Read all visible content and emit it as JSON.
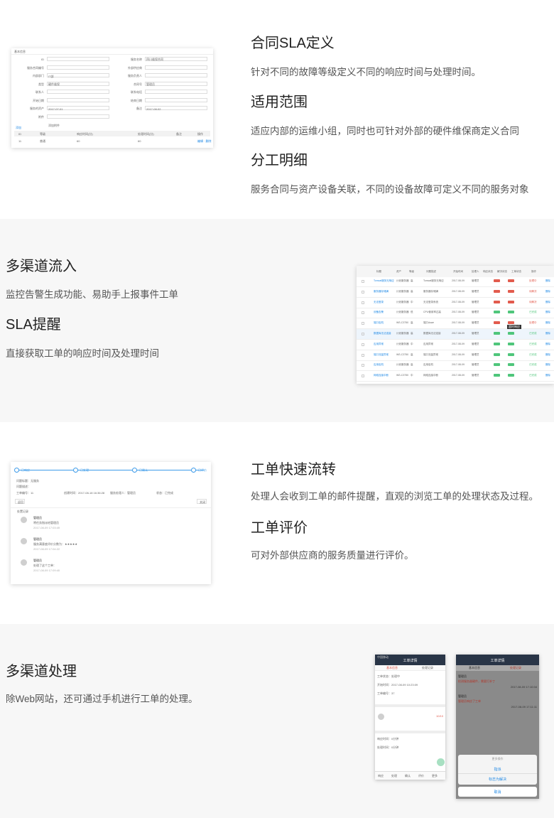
{
  "sections": {
    "sla": {
      "title1": "合同SLA定义",
      "desc1": "针对不同的故障等级定义不同的响应时间与处理时间。",
      "title2": "适用范围",
      "desc2": "适应内部的运维小组，同时也可针对外部的硬件维保商定义合同",
      "title3": "分工明细",
      "desc3": "服务合同与资产设备关联，不同的设备故障可定义不同的服务对象"
    },
    "channels": {
      "title1": "多渠道流入",
      "desc1": "监控告警生成功能、易助手上报事件工单",
      "title2": "SLA提醒",
      "desc2": "直接获取工单的响应时间及处理时间"
    },
    "flow": {
      "title1": "工单快速流转",
      "desc1": "处理人会收到工单的邮件提醒，直观的浏览工单的处理状态及过程。",
      "title2": "工单评价",
      "desc2": "可对外部供应商的服务质量进行评价。"
    },
    "mobile": {
      "title1": "多渠道处理",
      "desc1": "除Web网站，还可通过手机进行工单的处理。"
    }
  },
  "shot_sla": {
    "header": "基本信息",
    "labels": [
      "ID",
      "服务合同编号",
      "内部部门",
      "类型",
      "联系人",
      "开始日期",
      "服务的资产",
      "附件"
    ],
    "right_labels": [
      "服务名称",
      "外部供应商",
      "服务负责人",
      "合同号",
      "联系电话",
      "结束日期",
      "备注"
    ],
    "values": [
      "四川维保合同",
      "IT部",
      "硬件维保",
      "管理员",
      "2017-07-01",
      "2017-08-02",
      "添加附件"
    ],
    "table_head": [
      "ID",
      "等级",
      "响应时间(分)",
      "处理时间(分)",
      "备注",
      "操作"
    ],
    "table_row": [
      "11",
      "普通",
      "60",
      "60",
      "",
      "编辑 · 删除"
    ],
    "add_label": "添加"
  },
  "shot_list": {
    "head": [
      "标题",
      "资产",
      "等级",
      "问题描述",
      "开始时间",
      "处理人",
      "响应状态",
      "解决状态",
      "工单状态",
      "操作"
    ],
    "rows": [
      [
        "Tomcat服务无响应",
        "计划服务器",
        "高",
        "Tomcat服务无响应",
        "2017-08-09",
        "管理员",
        "处理中",
        "删除"
      ],
      [
        "服务器存储满",
        "计划服务器",
        "高",
        "服务器存储满",
        "2017-08-09",
        "管理员",
        "待解决",
        "删除"
      ],
      [
        "无法登录",
        "计划服务器",
        "中",
        "无法登录系统",
        "2017-08-09",
        "管理员",
        "待解决",
        "删除"
      ],
      [
        "设备告警",
        "计划服务器",
        "低",
        "CPU使用率过高",
        "2017-08-09",
        "管理员",
        "已完成",
        "删除"
      ],
      [
        "端口宕机",
        "WS-C3750",
        "高",
        "端口down",
        "2017-08-09",
        "管理员",
        "处理中",
        "删除"
      ],
      [
        "数据库无法连接",
        "计划服务器",
        "高",
        "数据库无法连接",
        "2017-08-09",
        "管理员",
        "已完成",
        "删除"
      ],
      [
        "应用异常",
        "计划服务器",
        "中",
        "应用异常",
        "2017-08-09",
        "管理员",
        "已完成",
        "删除"
      ],
      [
        "端口流量异常",
        "WS-C3750",
        "高",
        "端口流量异常",
        "2017-08-09",
        "管理员",
        "已完成",
        "删除"
      ],
      [
        "应用宕机",
        "计划服务器",
        "高",
        "应用宕机",
        "2017-08-09",
        "管理员",
        "已完成",
        "删除"
      ],
      [
        "网络连接中断",
        "WS-C3750",
        "中",
        "网络连接中断",
        "2017-08-09",
        "管理员",
        "已完成",
        "删除"
      ]
    ],
    "tooltip": "超时响应"
  },
  "shot_flow": {
    "steps": [
      "已响应",
      "已处理",
      "已确认",
      "已评价"
    ],
    "info": [
      "问题标题：无服务",
      "问题描述：",
      "工单编号：11",
      "创建时间：2017-08-18 16:36:28",
      "服务处理人：管理员",
      "状态：已完成"
    ],
    "btn_left": "返回",
    "btn_right": "关闭",
    "log_header": "处置记录",
    "logs": [
      {
        "user": "管理员",
        "text": "将任务指派给管理员",
        "time": "2017-08-09 17:03:49"
      },
      {
        "user": "管理员",
        "text": "服务满意度评价分数为：★★★★★",
        "time": "2017-08-09 17:04:22"
      },
      {
        "user": "管理员",
        "text": "处理了这个工单：",
        "time": "2017-08-09 17:09:40"
      }
    ]
  },
  "shot_phone1": {
    "status": "中国移动",
    "title": "工单详情",
    "tabs": [
      "基本信息",
      "处理记录"
    ],
    "fields": [
      "工单状态：处理中",
      "开始时间：2017-08-09 10:23:09",
      "工单编号：37"
    ],
    "fields2": [
      "响应时间：0分钟",
      "处理时间：0分钟"
    ],
    "badge": "10/10",
    "actions": [
      "响应",
      "处理",
      "确认",
      "评价",
      "更多"
    ]
  },
  "shot_phone2": {
    "title": "工单详情",
    "tabs": [
      "基本信息",
      "处理记录"
    ],
    "logs": [
      {
        "user": "管理员",
        "text": "检测服务器硬件，需要打补丁",
        "time": "2017-08-09 17:10:34"
      },
      {
        "user": "管理员",
        "text": "管理员响应了工单",
        "time": "2017-08-09 17:11:11"
      }
    ],
    "sheet_title": "更多操作",
    "sheet_items": [
      "指派",
      "标志为解决"
    ],
    "cancel": "取消"
  },
  "colors": {
    "accent": "#1e88e5",
    "section_alt_bg": "#f7f7f7",
    "phone_header": "#293547",
    "tag_red": "#e25b4d",
    "tag_green": "#4fc67b"
  }
}
